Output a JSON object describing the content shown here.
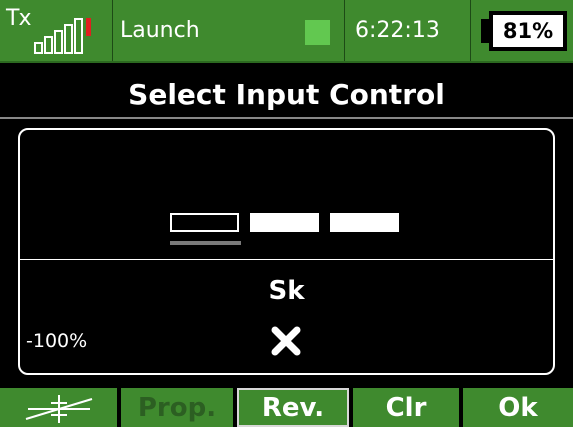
{
  "status_bar": {
    "tx_label": "Tx",
    "model_name": "Launch",
    "time": "6:22:13",
    "battery": "81%",
    "icons": {
      "signal": "signal-bars-icon",
      "model_status": "green-square-indicator",
      "battery": "battery-icon"
    }
  },
  "dialog": {
    "title": "Select Input Control",
    "source_name": "Sk",
    "value": "-100%",
    "value_icon": "x-icon"
  },
  "softkeys": [
    {
      "label": "",
      "icon": "curve-trim-icon",
      "state": "normal"
    },
    {
      "label": "Prop.",
      "state": "disabled"
    },
    {
      "label": "Rev.",
      "state": "selected"
    },
    {
      "label": "Clr",
      "state": "normal"
    },
    {
      "label": "Ok",
      "state": "normal"
    }
  ],
  "colors": {
    "accent": "#3f8a2e",
    "background": "#000000",
    "signal_warning": "#e02020",
    "indicator": "#62c850"
  }
}
